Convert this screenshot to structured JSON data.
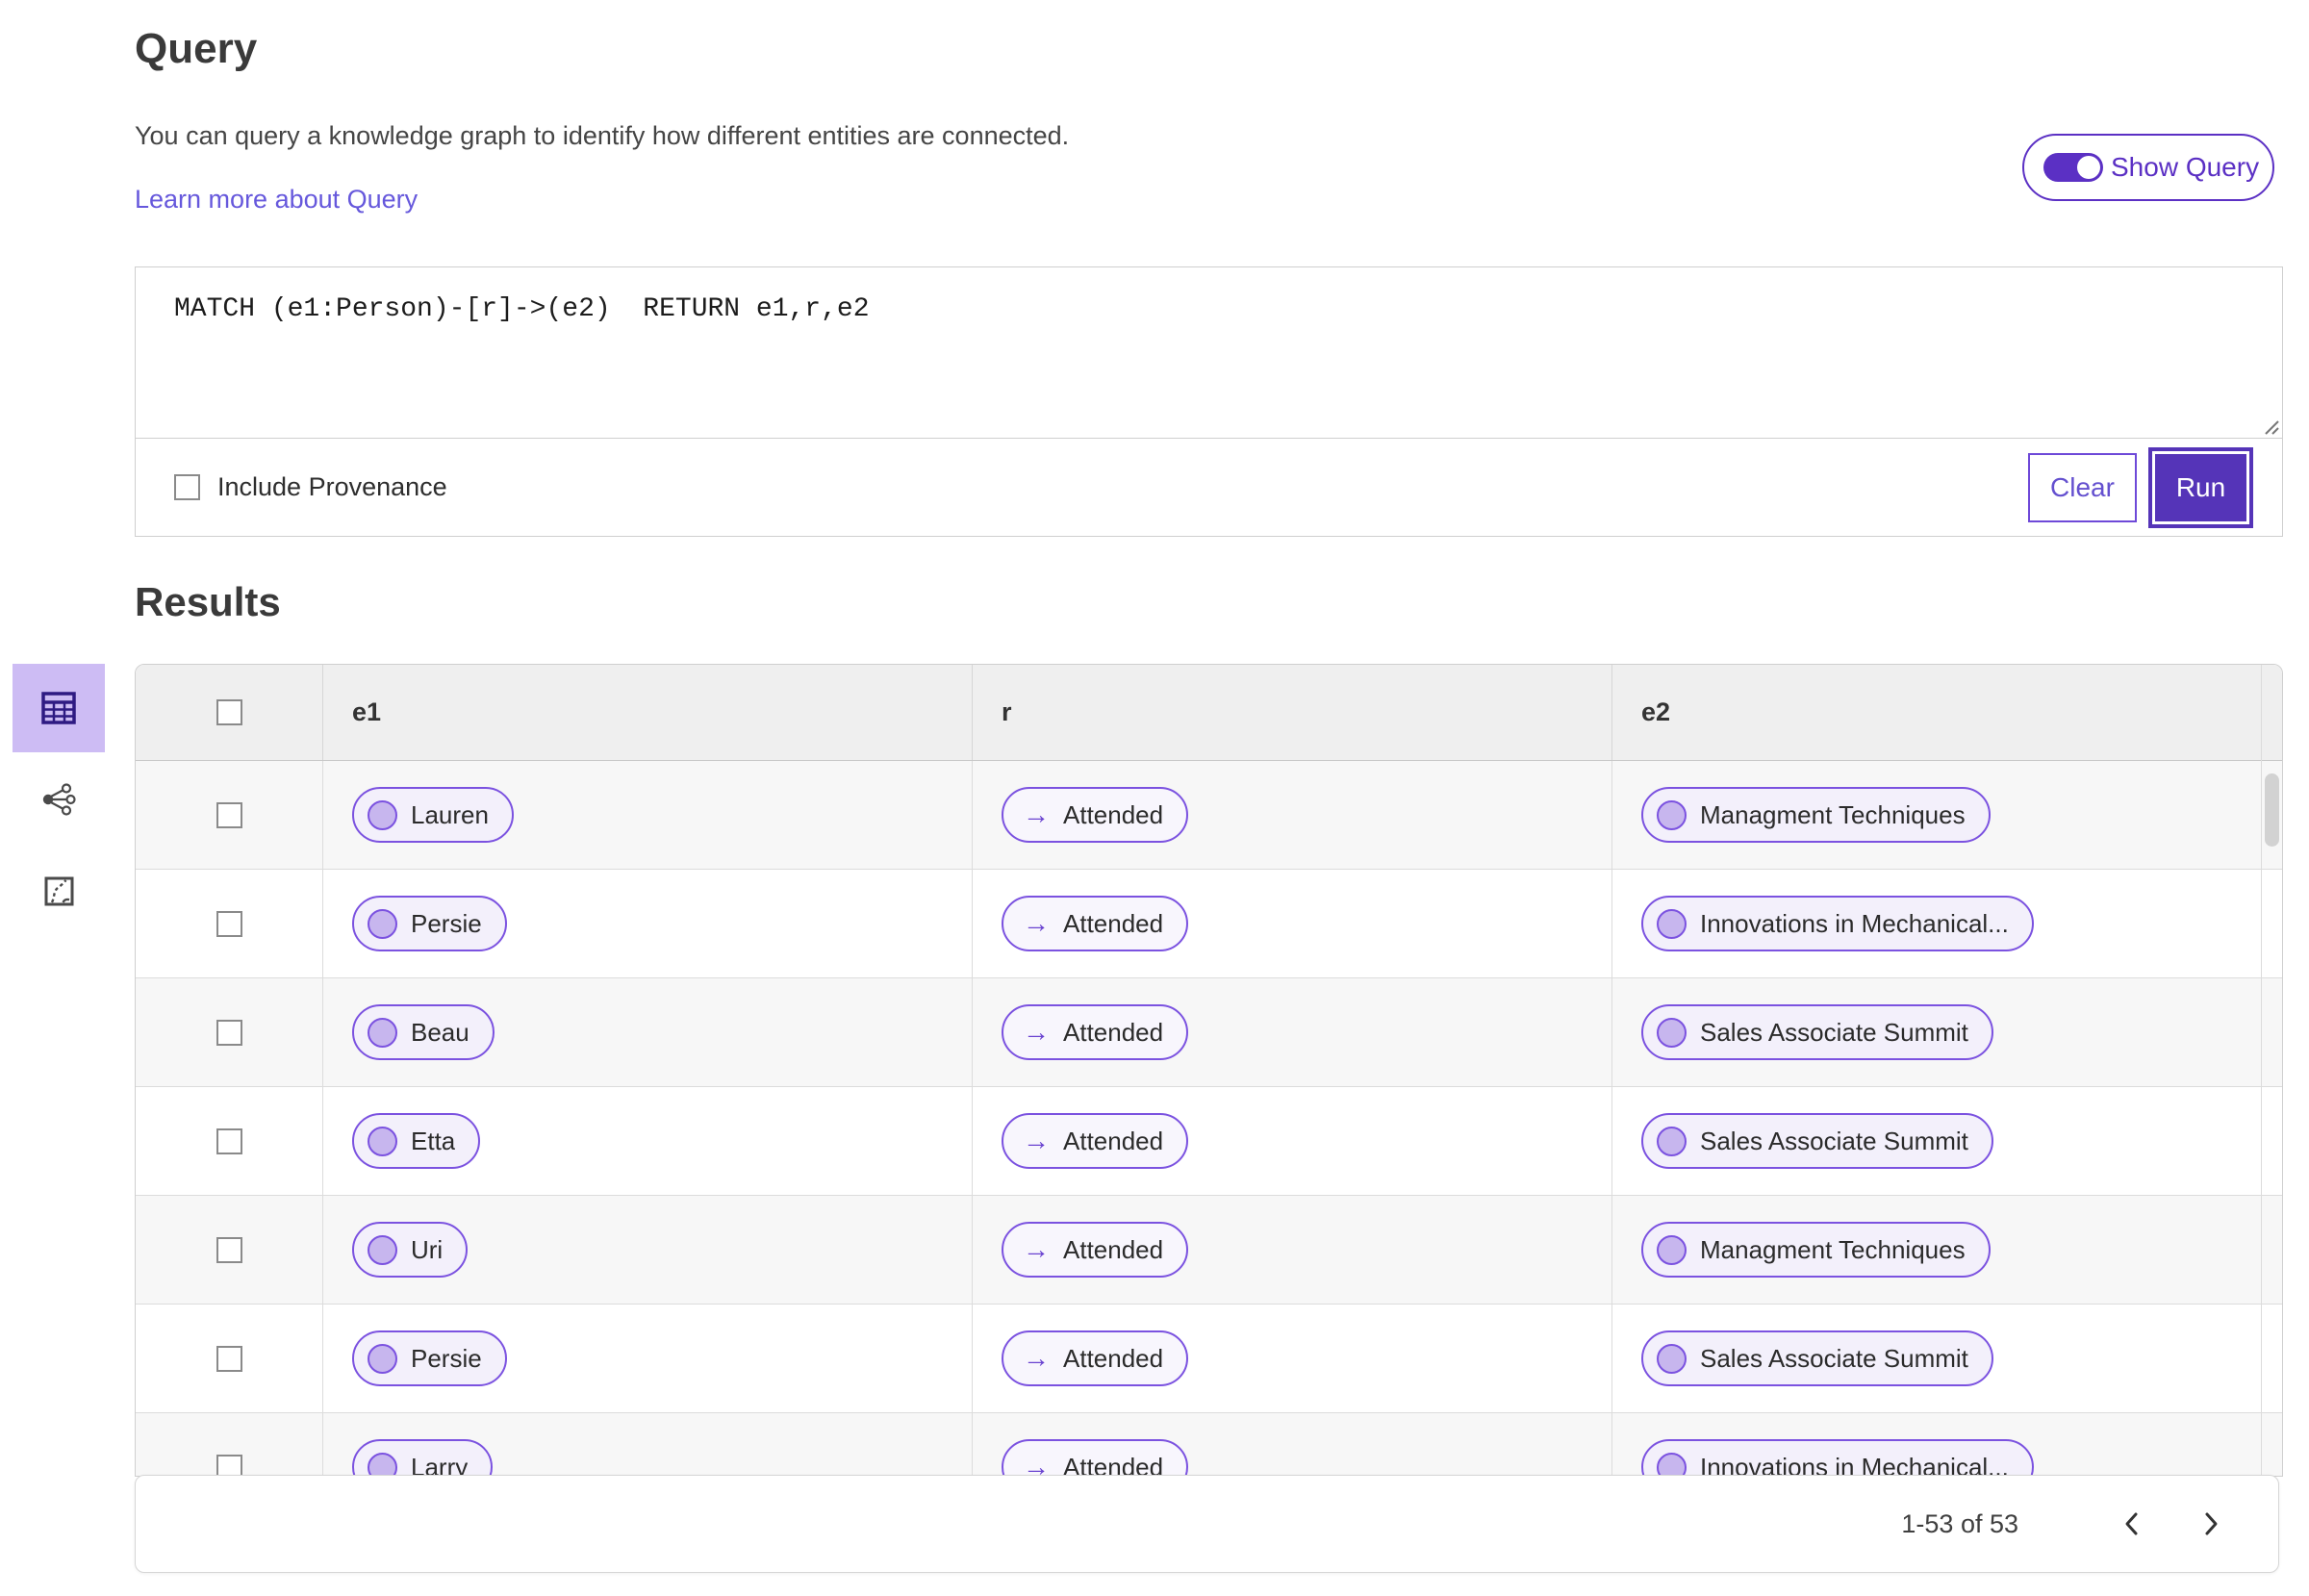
{
  "colors": {
    "accent": "#5534b8",
    "pill_border": "#7b52e0",
    "pill_entity_bg": "#f3f0fb",
    "pill_circle": "#c7b6ee",
    "link": "#6658dc",
    "selected_view_bg": "#cdbcf4",
    "table_header_bg": "#efefef",
    "row_alt_bg": "#f7f7f7"
  },
  "icons": {
    "arrow_right": "→"
  },
  "query_section": {
    "title": "Query",
    "description": "You can query a knowledge graph to identify how different entities are connected.",
    "link_label": "Learn more about Query",
    "show_query_label": "Show Query",
    "show_query_on": true,
    "query_text": "MATCH (e1:Person)-[r]->(e2)  RETURN e1,r,e2",
    "include_provenance_label": "Include Provenance",
    "include_provenance_checked": false,
    "clear_label": "Clear",
    "run_label": "Run"
  },
  "results_section": {
    "title": "Results",
    "views": [
      {
        "name": "table-view",
        "selected": true
      },
      {
        "name": "graph-view",
        "selected": false
      },
      {
        "name": "route-view",
        "selected": false
      }
    ],
    "table": {
      "columns": {
        "e1": "e1",
        "r": "r",
        "e2": "e2"
      },
      "rows": [
        {
          "e1": "Lauren",
          "r": "Attended",
          "e2": "Managment Techniques"
        },
        {
          "e1": "Persie",
          "r": "Attended",
          "e2": "Innovations in Mechanical..."
        },
        {
          "e1": "Beau",
          "r": "Attended",
          "e2": "Sales Associate Summit"
        },
        {
          "e1": "Etta",
          "r": "Attended",
          "e2": "Sales Associate Summit"
        },
        {
          "e1": "Uri",
          "r": "Attended",
          "e2": "Managment Techniques"
        },
        {
          "e1": "Persie",
          "r": "Attended",
          "e2": "Sales Associate Summit"
        },
        {
          "e1": "Larry",
          "r": "Attended",
          "e2": "Innovations in Mechanical..."
        }
      ]
    },
    "pagination": {
      "range_label": "1-53 of 53"
    }
  }
}
